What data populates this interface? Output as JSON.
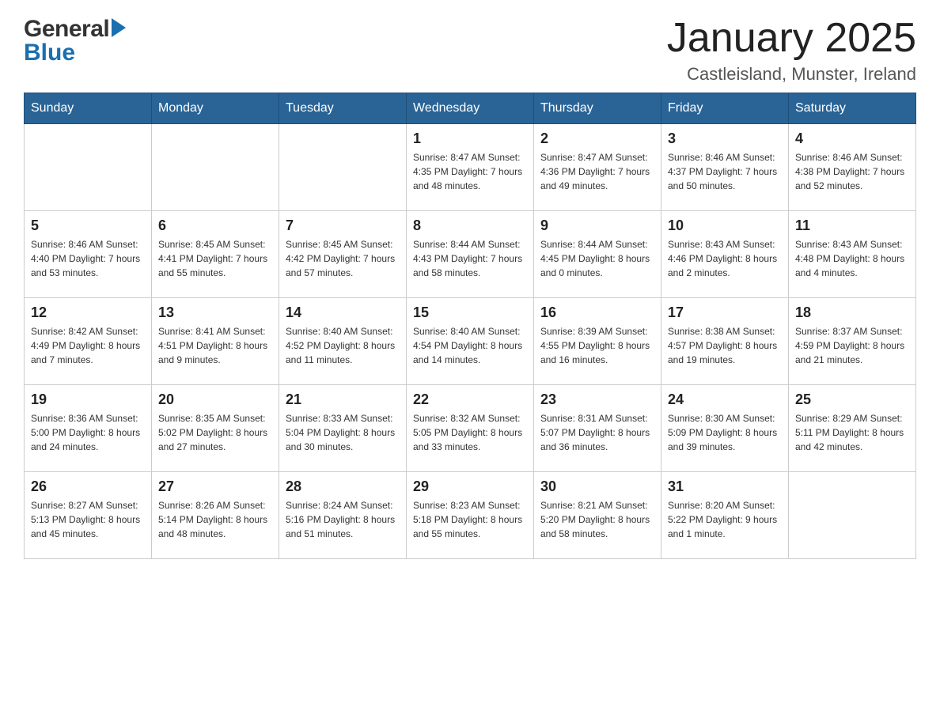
{
  "header": {
    "logo_general": "General",
    "logo_blue": "Blue",
    "month_title": "January 2025",
    "location": "Castleisland, Munster, Ireland"
  },
  "calendar": {
    "days_of_week": [
      "Sunday",
      "Monday",
      "Tuesday",
      "Wednesday",
      "Thursday",
      "Friday",
      "Saturday"
    ],
    "weeks": [
      [
        {
          "day": "",
          "info": ""
        },
        {
          "day": "",
          "info": ""
        },
        {
          "day": "",
          "info": ""
        },
        {
          "day": "1",
          "info": "Sunrise: 8:47 AM\nSunset: 4:35 PM\nDaylight: 7 hours\nand 48 minutes."
        },
        {
          "day": "2",
          "info": "Sunrise: 8:47 AM\nSunset: 4:36 PM\nDaylight: 7 hours\nand 49 minutes."
        },
        {
          "day": "3",
          "info": "Sunrise: 8:46 AM\nSunset: 4:37 PM\nDaylight: 7 hours\nand 50 minutes."
        },
        {
          "day": "4",
          "info": "Sunrise: 8:46 AM\nSunset: 4:38 PM\nDaylight: 7 hours\nand 52 minutes."
        }
      ],
      [
        {
          "day": "5",
          "info": "Sunrise: 8:46 AM\nSunset: 4:40 PM\nDaylight: 7 hours\nand 53 minutes."
        },
        {
          "day": "6",
          "info": "Sunrise: 8:45 AM\nSunset: 4:41 PM\nDaylight: 7 hours\nand 55 minutes."
        },
        {
          "day": "7",
          "info": "Sunrise: 8:45 AM\nSunset: 4:42 PM\nDaylight: 7 hours\nand 57 minutes."
        },
        {
          "day": "8",
          "info": "Sunrise: 8:44 AM\nSunset: 4:43 PM\nDaylight: 7 hours\nand 58 minutes."
        },
        {
          "day": "9",
          "info": "Sunrise: 8:44 AM\nSunset: 4:45 PM\nDaylight: 8 hours\nand 0 minutes."
        },
        {
          "day": "10",
          "info": "Sunrise: 8:43 AM\nSunset: 4:46 PM\nDaylight: 8 hours\nand 2 minutes."
        },
        {
          "day": "11",
          "info": "Sunrise: 8:43 AM\nSunset: 4:48 PM\nDaylight: 8 hours\nand 4 minutes."
        }
      ],
      [
        {
          "day": "12",
          "info": "Sunrise: 8:42 AM\nSunset: 4:49 PM\nDaylight: 8 hours\nand 7 minutes."
        },
        {
          "day": "13",
          "info": "Sunrise: 8:41 AM\nSunset: 4:51 PM\nDaylight: 8 hours\nand 9 minutes."
        },
        {
          "day": "14",
          "info": "Sunrise: 8:40 AM\nSunset: 4:52 PM\nDaylight: 8 hours\nand 11 minutes."
        },
        {
          "day": "15",
          "info": "Sunrise: 8:40 AM\nSunset: 4:54 PM\nDaylight: 8 hours\nand 14 minutes."
        },
        {
          "day": "16",
          "info": "Sunrise: 8:39 AM\nSunset: 4:55 PM\nDaylight: 8 hours\nand 16 minutes."
        },
        {
          "day": "17",
          "info": "Sunrise: 8:38 AM\nSunset: 4:57 PM\nDaylight: 8 hours\nand 19 minutes."
        },
        {
          "day": "18",
          "info": "Sunrise: 8:37 AM\nSunset: 4:59 PM\nDaylight: 8 hours\nand 21 minutes."
        }
      ],
      [
        {
          "day": "19",
          "info": "Sunrise: 8:36 AM\nSunset: 5:00 PM\nDaylight: 8 hours\nand 24 minutes."
        },
        {
          "day": "20",
          "info": "Sunrise: 8:35 AM\nSunset: 5:02 PM\nDaylight: 8 hours\nand 27 minutes."
        },
        {
          "day": "21",
          "info": "Sunrise: 8:33 AM\nSunset: 5:04 PM\nDaylight: 8 hours\nand 30 minutes."
        },
        {
          "day": "22",
          "info": "Sunrise: 8:32 AM\nSunset: 5:05 PM\nDaylight: 8 hours\nand 33 minutes."
        },
        {
          "day": "23",
          "info": "Sunrise: 8:31 AM\nSunset: 5:07 PM\nDaylight: 8 hours\nand 36 minutes."
        },
        {
          "day": "24",
          "info": "Sunrise: 8:30 AM\nSunset: 5:09 PM\nDaylight: 8 hours\nand 39 minutes."
        },
        {
          "day": "25",
          "info": "Sunrise: 8:29 AM\nSunset: 5:11 PM\nDaylight: 8 hours\nand 42 minutes."
        }
      ],
      [
        {
          "day": "26",
          "info": "Sunrise: 8:27 AM\nSunset: 5:13 PM\nDaylight: 8 hours\nand 45 minutes."
        },
        {
          "day": "27",
          "info": "Sunrise: 8:26 AM\nSunset: 5:14 PM\nDaylight: 8 hours\nand 48 minutes."
        },
        {
          "day": "28",
          "info": "Sunrise: 8:24 AM\nSunset: 5:16 PM\nDaylight: 8 hours\nand 51 minutes."
        },
        {
          "day": "29",
          "info": "Sunrise: 8:23 AM\nSunset: 5:18 PM\nDaylight: 8 hours\nand 55 minutes."
        },
        {
          "day": "30",
          "info": "Sunrise: 8:21 AM\nSunset: 5:20 PM\nDaylight: 8 hours\nand 58 minutes."
        },
        {
          "day": "31",
          "info": "Sunrise: 8:20 AM\nSunset: 5:22 PM\nDaylight: 9 hours\nand 1 minute."
        },
        {
          "day": "",
          "info": ""
        }
      ]
    ]
  }
}
